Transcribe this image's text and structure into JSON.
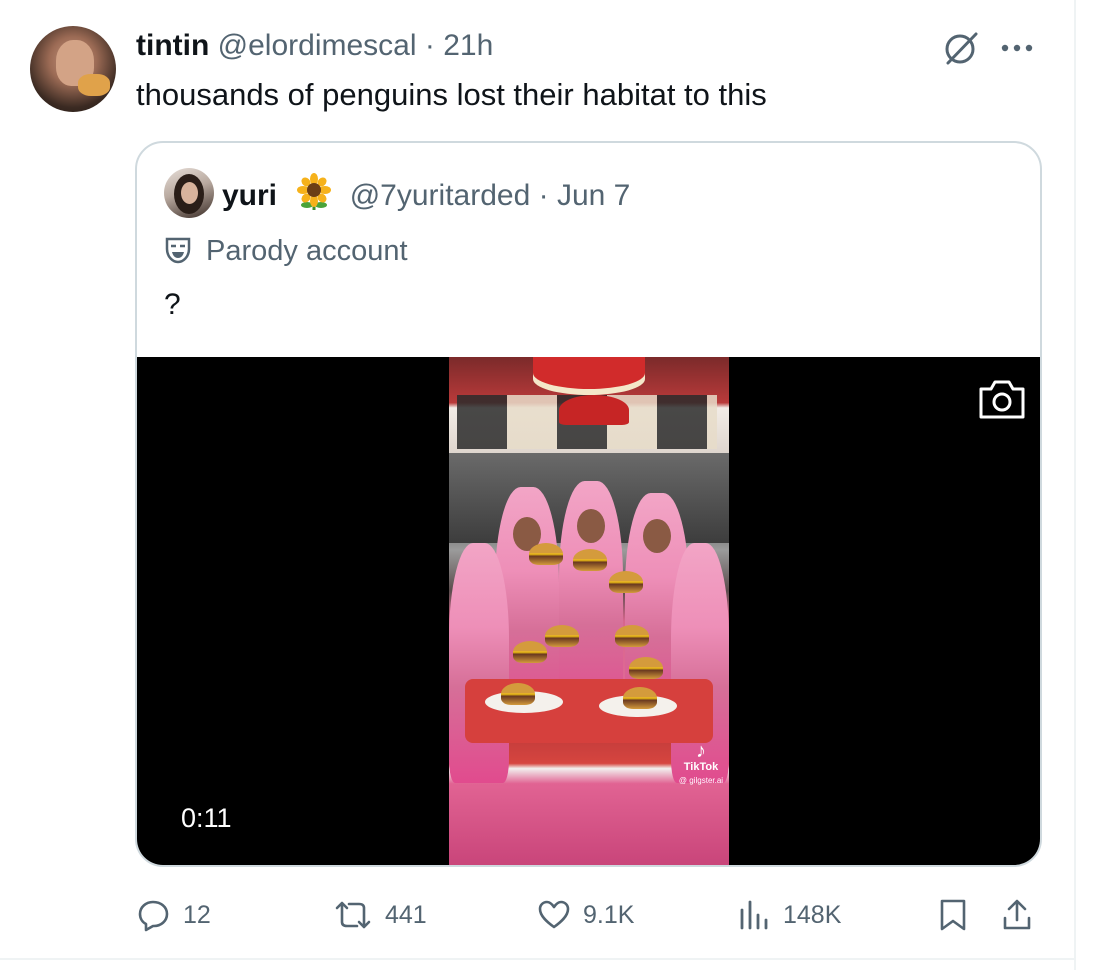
{
  "tweet": {
    "display_name": "tintin",
    "handle": "@elordimescal",
    "separator": "·",
    "time": "21h",
    "text": "thousands of penguins lost their habitat to this"
  },
  "quote": {
    "display_name": "yuri",
    "emoji": "sunflower",
    "handle": "@7yuritarded",
    "separator": "·",
    "date": "Jun 7",
    "label": "Parody account",
    "text": "?",
    "video": {
      "timestamp": "0:11",
      "watermark_brand": "TikTok",
      "watermark_user": "@ gilgster.ai"
    }
  },
  "actions": {
    "replies": "12",
    "reposts": "441",
    "likes": "9.1K",
    "views": "148K"
  },
  "icons": {
    "more": "more-icon",
    "grok": "grok-icon",
    "reply": "reply-icon",
    "repost": "repost-icon",
    "like": "heart-icon",
    "views": "views-icon",
    "bookmark": "bookmark-icon",
    "share": "share-icon",
    "camera": "camera-icon",
    "parody": "parody-mask-icon"
  },
  "colors": {
    "text_primary": "#0f1419",
    "text_secondary": "#536471",
    "border": "#cfd9de",
    "video_bg": "#000000"
  }
}
